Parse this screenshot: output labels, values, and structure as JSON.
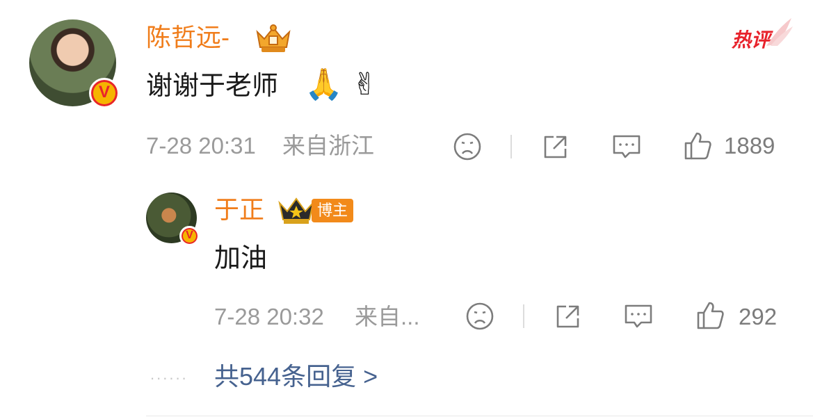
{
  "comment": {
    "author": "陈哲远-",
    "verified_mark": "V",
    "hot_label": "热评",
    "text": "谢谢于老师",
    "emojis": [
      "🙏",
      "✌"
    ],
    "time": "7-28 20:31",
    "location": "来自浙江",
    "likes": "1889"
  },
  "reply": {
    "author": "于正",
    "host_badge": "博主",
    "verified_mark": "V",
    "text": "加油",
    "time": "7-28 20:32",
    "location": "来自...",
    "likes": "292"
  },
  "more_replies": "共544条回复 >",
  "dots": "......",
  "colors": {
    "name": "#f07d1b",
    "link": "#46628f",
    "hot": "#e8232c",
    "badge": "#f28a1a"
  },
  "icons": [
    "sad-face-icon",
    "share-icon",
    "comment-icon",
    "thumbs-up-icon",
    "crown-icon"
  ]
}
